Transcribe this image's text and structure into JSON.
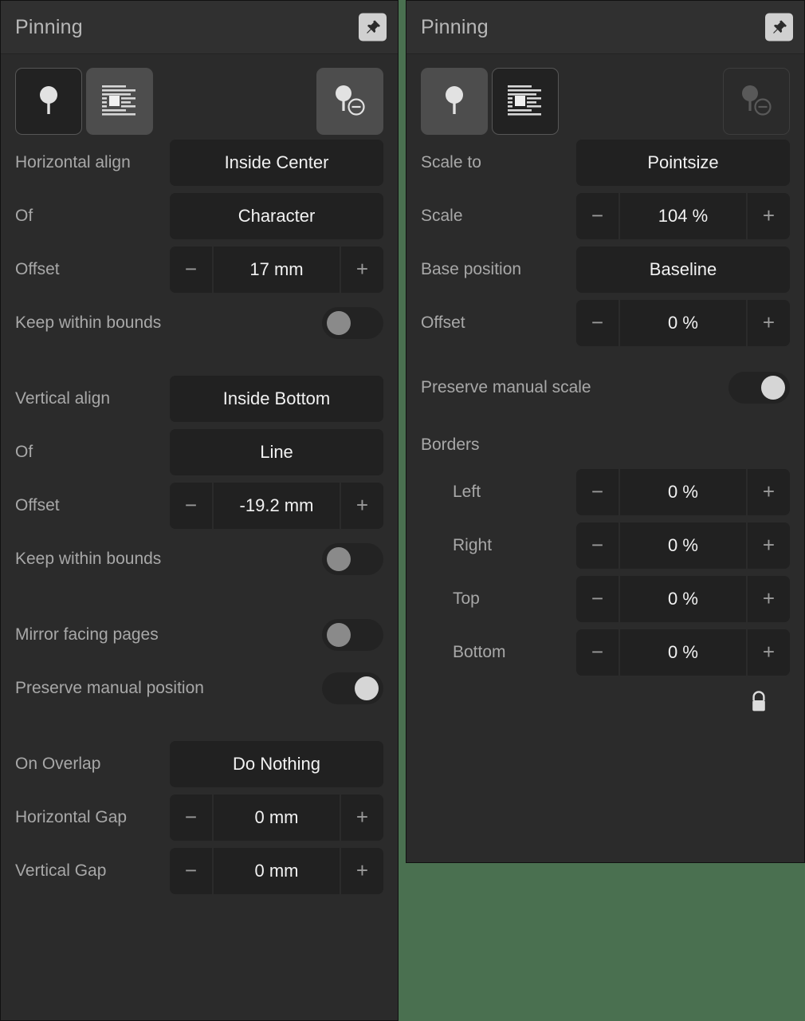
{
  "theme": {
    "background": "#4a7050",
    "panel_bg": "#2b2b2b",
    "header_bg": "#303030",
    "control_bg": "#212121",
    "label_color": "#a8a8a8",
    "value_color": "#f2f2f2",
    "toggle_off_knob": "#8a8a8a",
    "toggle_on_knob": "#d6d6d6"
  },
  "left_panel": {
    "header": {
      "title": "Pinning",
      "pin_button": "pin-icon"
    },
    "iconbar": {
      "buttons": [
        {
          "name": "anchor-pin-icon",
          "state": "unselected"
        },
        {
          "name": "text-wrap-anchor-icon",
          "state": "selected"
        },
        {
          "name": "remove-pin-icon",
          "state": "enabled"
        }
      ]
    },
    "rows": [
      {
        "type": "combo",
        "label": "Horizontal align",
        "value": "Inside Center"
      },
      {
        "type": "combo",
        "label": "Of",
        "value": "Character"
      },
      {
        "type": "stepper",
        "label": "Offset",
        "value": "17 mm",
        "minus": "−",
        "plus": "+"
      },
      {
        "type": "toggle",
        "label": "Keep within bounds",
        "value": "off"
      },
      {
        "type": "gap"
      },
      {
        "type": "combo",
        "label": "Vertical align",
        "value": "Inside Bottom"
      },
      {
        "type": "combo",
        "label": "Of",
        "value": "Line"
      },
      {
        "type": "stepper",
        "label": "Offset",
        "value": "-19.2 mm",
        "minus": "−",
        "plus": "+"
      },
      {
        "type": "toggle",
        "label": "Keep within bounds",
        "value": "off"
      },
      {
        "type": "gap"
      },
      {
        "type": "toggle",
        "label": "Mirror facing pages",
        "value": "off"
      },
      {
        "type": "toggle",
        "label": "Preserve manual position",
        "value": "on"
      },
      {
        "type": "gap"
      },
      {
        "type": "combo",
        "label": "On Overlap",
        "value": "Do Nothing"
      },
      {
        "type": "stepper",
        "label": "Horizontal Gap",
        "value": "0 mm",
        "minus": "−",
        "plus": "+"
      },
      {
        "type": "stepper",
        "label": "Vertical Gap",
        "value": "0 mm",
        "minus": "−",
        "plus": "+"
      }
    ]
  },
  "right_panel": {
    "header": {
      "title": "Pinning",
      "pin_button": "pin-icon"
    },
    "iconbar": {
      "buttons": [
        {
          "name": "anchor-pin-icon",
          "state": "selected"
        },
        {
          "name": "text-wrap-anchor-icon",
          "state": "unselected"
        },
        {
          "name": "remove-pin-icon",
          "state": "disabled"
        }
      ]
    },
    "rows": [
      {
        "type": "combo",
        "label": "Scale to",
        "value": "Pointsize"
      },
      {
        "type": "stepper",
        "label": "Scale",
        "value": "104 %",
        "minus": "−",
        "plus": "+"
      },
      {
        "type": "combo",
        "label": "Base position",
        "value": "Baseline"
      },
      {
        "type": "stepper",
        "label": "Offset",
        "value": "0 %",
        "minus": "−",
        "plus": "+"
      },
      {
        "type": "gap-sm"
      },
      {
        "type": "toggle",
        "label": "Preserve manual scale",
        "value": "on"
      },
      {
        "type": "gap-sm"
      },
      {
        "type": "section",
        "label": "Borders"
      },
      {
        "type": "stepper",
        "label": "Left",
        "indent": true,
        "value": "0 %",
        "minus": "−",
        "plus": "+"
      },
      {
        "type": "stepper",
        "label": "Right",
        "indent": true,
        "value": "0 %",
        "minus": "−",
        "plus": "+"
      },
      {
        "type": "stepper",
        "label": "Top",
        "indent": true,
        "value": "0 %",
        "minus": "−",
        "plus": "+"
      },
      {
        "type": "stepper",
        "label": "Bottom",
        "indent": true,
        "value": "0 %",
        "minus": "−",
        "plus": "+"
      }
    ],
    "lock": {
      "name": "lock-closed-icon",
      "state": "locked"
    }
  }
}
